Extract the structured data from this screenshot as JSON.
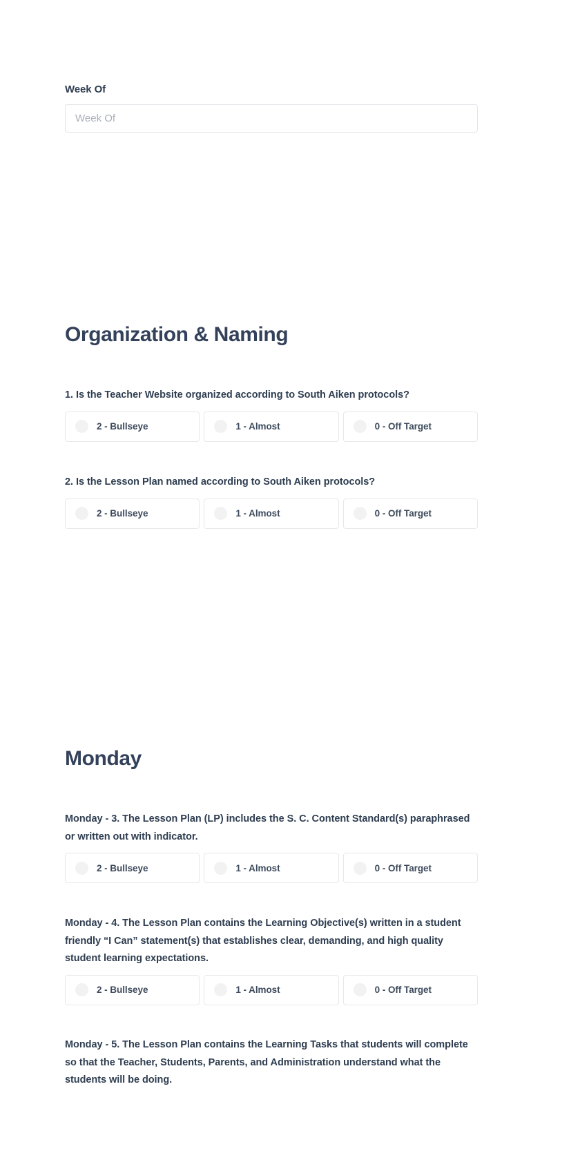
{
  "form": {
    "week_of": {
      "label": "Week Of",
      "value": "",
      "placeholder": "Week Of"
    },
    "sections": [
      {
        "heading": "Organization & Naming"
      },
      {
        "heading": "Monday"
      }
    ],
    "questions": [
      {
        "id": "q1",
        "text": "1. Is the Teacher Website organized according to South Aiken protocols?",
        "options": [
          {
            "label": "2 - Bullseye",
            "selected": false
          },
          {
            "label": "1 - Almost",
            "selected": false
          },
          {
            "label": "0 - Off Target",
            "selected": false
          }
        ]
      },
      {
        "id": "q2",
        "text": "2. Is the Lesson Plan named according to South Aiken protocols?",
        "options": [
          {
            "label": "2 - Bullseye",
            "selected": false
          },
          {
            "label": "1 - Almost",
            "selected": false
          },
          {
            "label": "0 - Off Target",
            "selected": false
          }
        ]
      },
      {
        "id": "q3",
        "text": "Monday - 3. The Lesson Plan (LP) includes the S. C. Content Standard(s) paraphrased or written out with indicator.",
        "options": [
          {
            "label": "2 - Bullseye",
            "selected": false
          },
          {
            "label": "1 - Almost",
            "selected": false
          },
          {
            "label": "0 - Off Target",
            "selected": false
          }
        ]
      },
      {
        "id": "q4",
        "text": "Monday - 4. The Lesson Plan contains the Learning Objective(s) written in a student friendly “I Can” statement(s) that establishes clear, demanding, and high quality student learning expectations.",
        "options": [
          {
            "label": "2 - Bullseye",
            "selected": false
          },
          {
            "label": "1 - Almost",
            "selected": false
          },
          {
            "label": "0 - Off Target",
            "selected": false
          }
        ]
      },
      {
        "id": "q5",
        "text": "Monday - 5. The Lesson Plan contains the Learning Tasks that students will complete so that the Teacher, Students, Parents, and Administration understand what the students will be doing.",
        "options": []
      }
    ]
  },
  "colors": {
    "heading": "#33415a",
    "text": "#2e3d50",
    "border": "#e6e8ea",
    "radio_fill": "#f2f2f3",
    "placeholder": "#a9afb8",
    "background": "#ffffff"
  }
}
